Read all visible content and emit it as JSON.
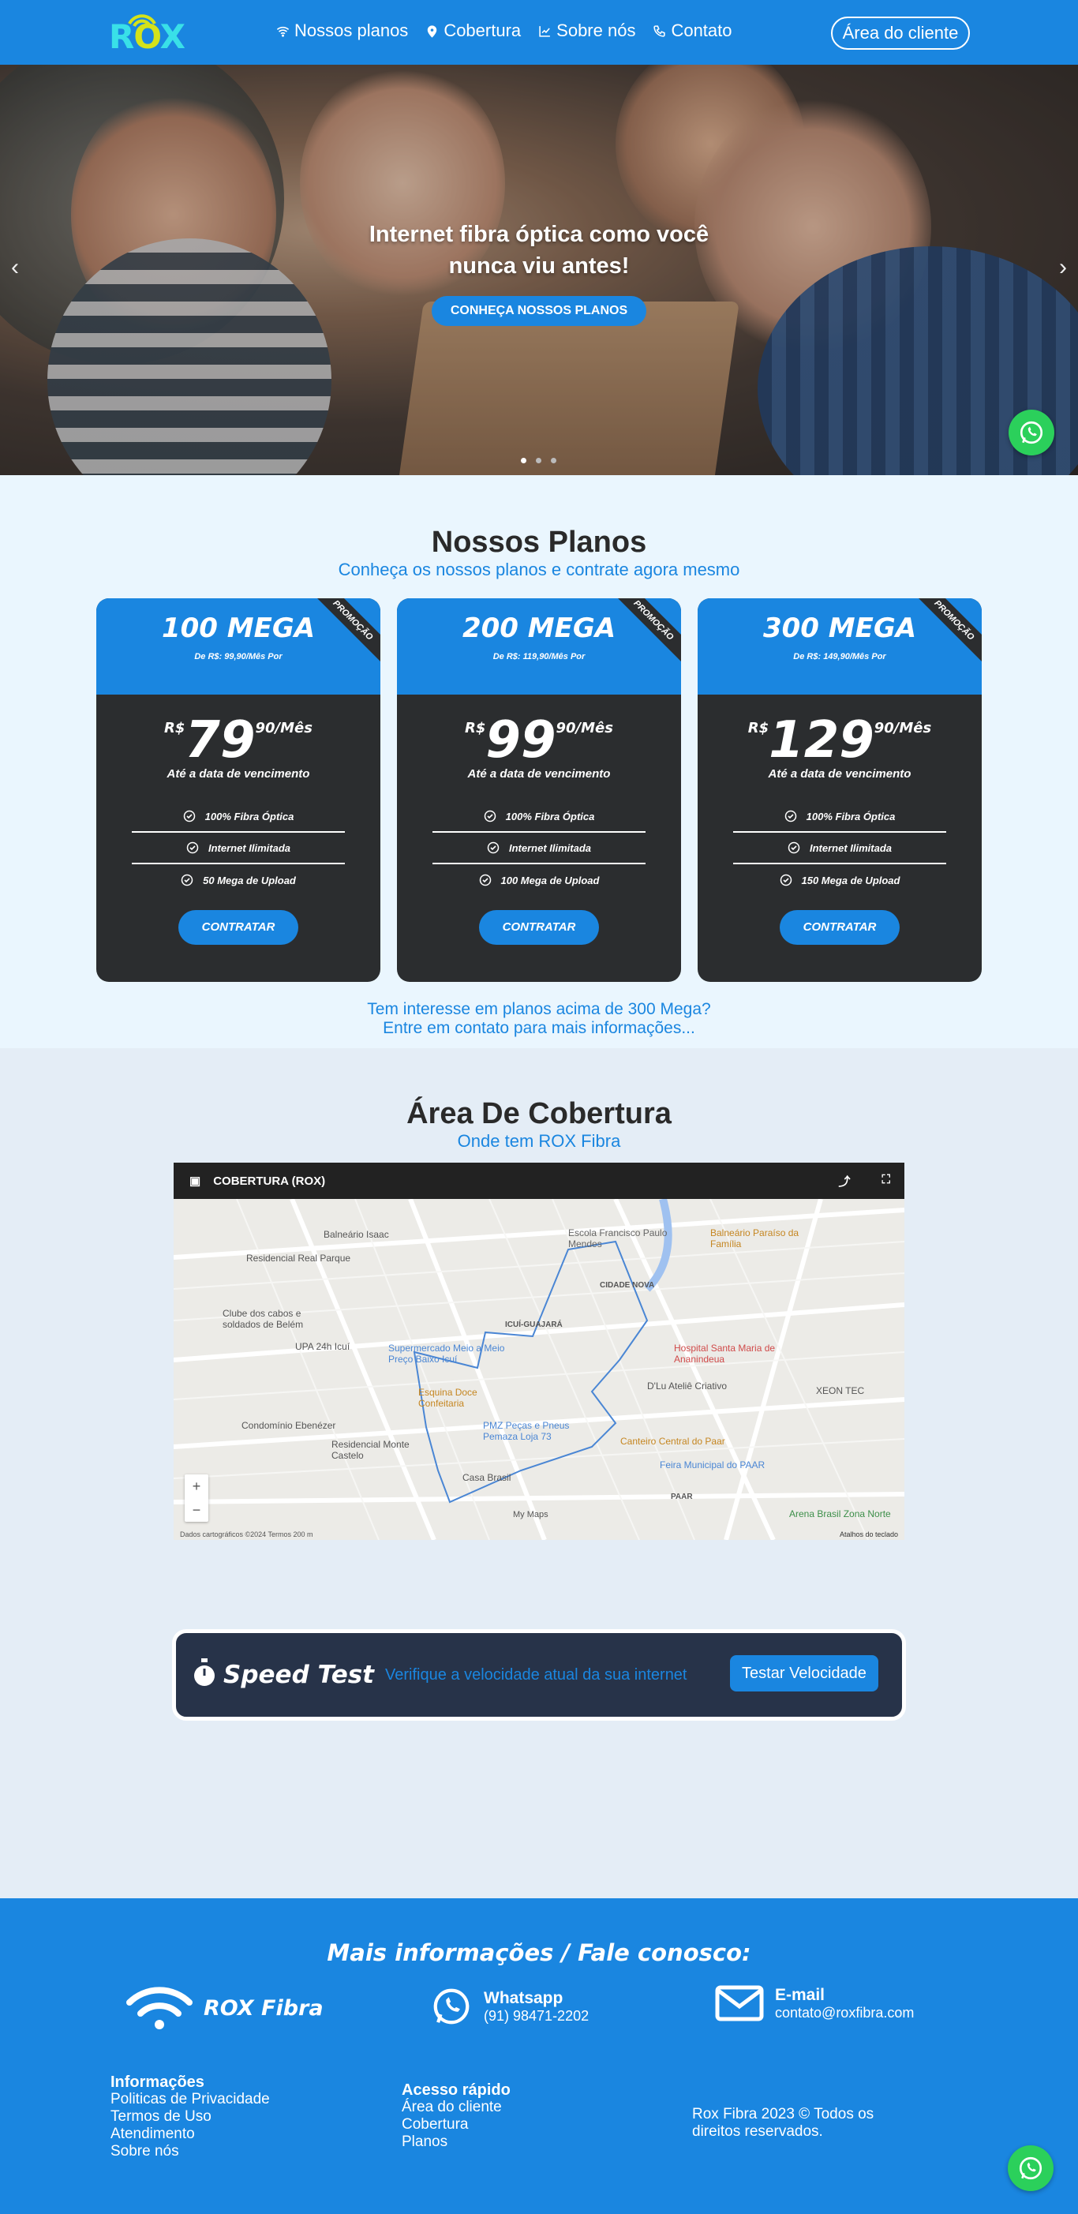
{
  "nav": {
    "logo": "ROX",
    "items": [
      {
        "label": "Nossos planos",
        "icon": "wifi-icon"
      },
      {
        "label": "Cobertura",
        "icon": "map-pin-icon"
      },
      {
        "label": "Sobre nós",
        "icon": "chart-icon"
      },
      {
        "label": "Contato",
        "icon": "phone-icon"
      }
    ],
    "client_button": "Área do cliente"
  },
  "hero": {
    "title": "Internet fibra óptica como você nunca viu antes!",
    "button": "CONHEÇA NOSSOS PLANOS",
    "active_slide": 1,
    "slides": 3
  },
  "plans": {
    "title": "Nossos Planos",
    "subtitle": "Conheça os nossos planos e contrate agora mesmo",
    "ribbon": "PROMOÇÃO",
    "currency": "R$",
    "due_text": "Até a data de vencimento",
    "contract_label": "CONTRATAR",
    "cards": [
      {
        "name": "100 MEGA",
        "old": "De R$: 99,90/Mês Por",
        "price": "79",
        "cents": "90/Mês",
        "features": [
          "100% Fibra Óptica",
          "Internet Ilimitada",
          "50 Mega de Upload"
        ]
      },
      {
        "name": "200 MEGA",
        "old": "De R$: 119,90/Mês Por",
        "price": "99",
        "cents": "90/Mês",
        "features": [
          "100% Fibra Óptica",
          "Internet Ilimitada",
          "100 Mega de Upload"
        ]
      },
      {
        "name": "300 MEGA",
        "old": "De R$: 149,90/Mês Por",
        "price": "129",
        "cents": "90/Mês",
        "features": [
          "100% Fibra Óptica",
          "Internet Ilimitada",
          "150 Mega de Upload"
        ]
      }
    ],
    "note_line1": "Tem interesse em planos acima de 300 Mega?",
    "note_line2": "Entre em contato para mais informações..."
  },
  "coverage": {
    "title": "Área De Cobertura",
    "subtitle": "Onde tem ROX Fibra",
    "map_title": "COBERTURA (ROX)",
    "map_footer": "Dados cartográficos ©2024   Termos   200 m",
    "map_footer_right": "Atalhos do teclado",
    "map_labels": [
      "Escola Francisco Paulo Mendes",
      "Balneário Paraíso da Família",
      "Residencial Real Parque",
      "Balneário Isaac",
      "Clube dos cabos e soldados de Belém",
      "UPA 24h Icuí",
      "Supermercado Meio a Meio Preço Baixo Icuí",
      "Hospital Santa Maria de Ananindeua",
      "D'Lu Ateliê Criativo",
      "XEON TEC",
      "Esquina Doce Confeitaria",
      "Condomínio Ebenézer",
      "Residencial Monte Castelo",
      "PMZ Peças e Pneus Pemaza Loja 73",
      "Canteiro Central do Paar",
      "Feira Municipal do PAAR",
      "Casa Brasil",
      "Arena Brasil Zona Norte",
      "CIDADE NOVA",
      "ICUÍ-GUAJARÁ",
      "PAAR",
      "My Maps"
    ]
  },
  "speedtest": {
    "title": "Speed Test",
    "text": "Verifique a velocidade atual da sua internet",
    "button": "Testar Velocidade"
  },
  "footer": {
    "title": "Mais informações / Fale conosco:",
    "brand": "ROX Fibra",
    "whatsapp_title": "Whatsapp",
    "whatsapp_number": "(91) 98471-2202",
    "email_title": "E-mail",
    "email": "contato@roxfibra.com",
    "info_title": "Informações",
    "info_links": [
      "Politicas de Privacidade",
      "Termos de Uso",
      "Atendimento",
      "Sobre nós"
    ],
    "quick_title": "Acesso rápido",
    "quick_links": [
      "Área do cliente",
      "Cobertura",
      "Planos"
    ],
    "copyright": "Rox Fibra 2023 © Todos os direitos reservados."
  },
  "colors": {
    "brand": "#1a86e0",
    "dark_card": "#2b2d2f",
    "whatsapp": "#2bd05b",
    "speed_bg": "#273349"
  }
}
